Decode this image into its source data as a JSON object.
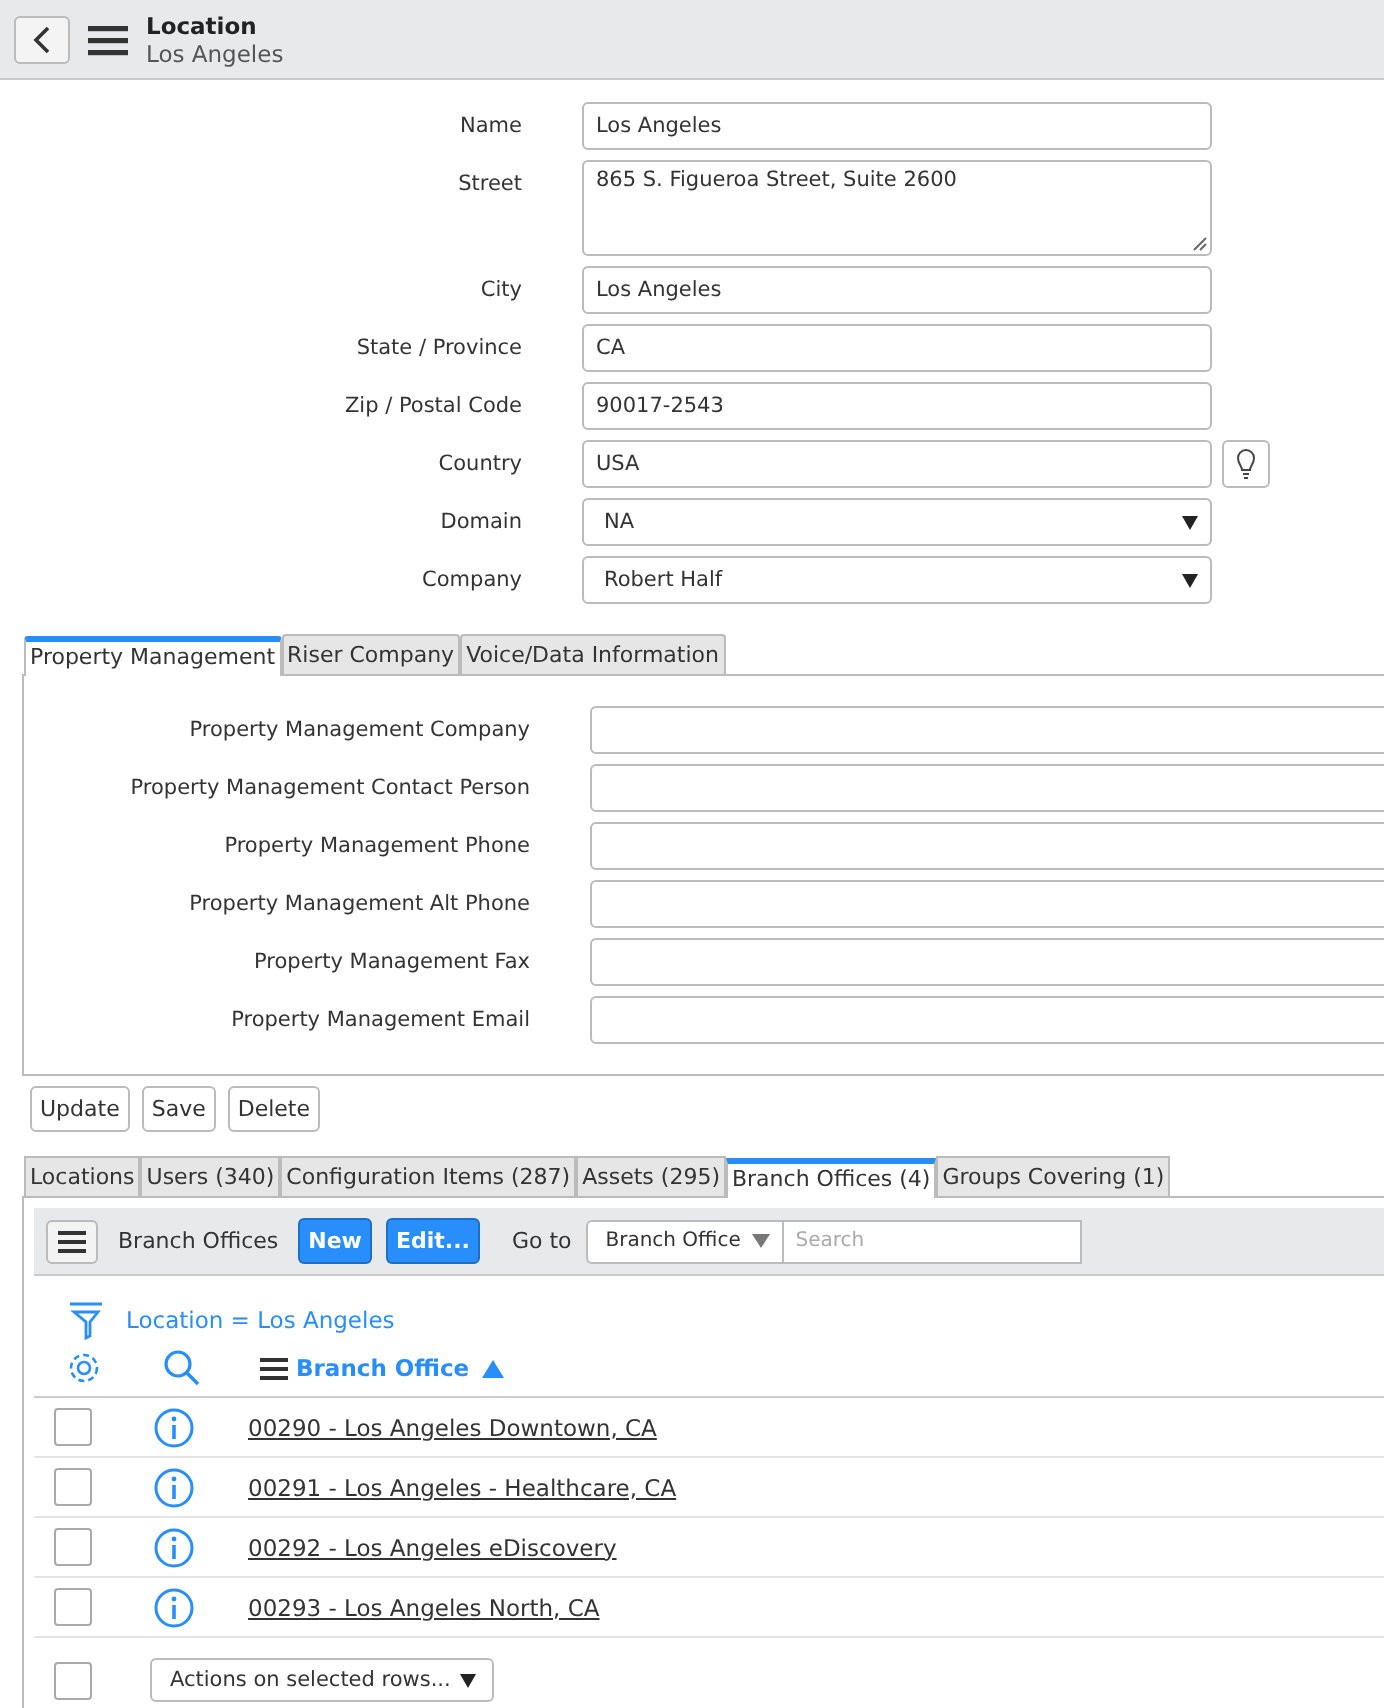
{
  "header": {
    "title": "Location",
    "subtitle": "Los Angeles"
  },
  "fields": [
    {
      "label": "Name",
      "value": "Los Angeles",
      "kind": "text"
    },
    {
      "label": "Street",
      "value": "865 S. Figueroa Street, Suite 2600",
      "kind": "textarea"
    },
    {
      "label": "City",
      "value": "Los Angeles",
      "kind": "text"
    },
    {
      "label": "State / Province",
      "value": "CA",
      "kind": "text"
    },
    {
      "label": "Zip / Postal Code",
      "value": "90017-2543",
      "kind": "text"
    },
    {
      "label": "Country",
      "value": "USA",
      "kind": "lookup"
    },
    {
      "label": "Domain",
      "value": "NA",
      "kind": "select"
    },
    {
      "label": "Company",
      "value": "Robert Half",
      "kind": "select"
    }
  ],
  "section_tabs": [
    {
      "label": "Property Management",
      "selected": true
    },
    {
      "label": "Riser Company",
      "selected": false
    },
    {
      "label": "Voice/Data Information",
      "selected": false
    }
  ],
  "section_fields": [
    {
      "label": "Property Management Company"
    },
    {
      "label": "Property Management Contact Person"
    },
    {
      "label": "Property Management Phone"
    },
    {
      "label": "Property Management Alt Phone"
    },
    {
      "label": "Property Management Fax"
    },
    {
      "label": "Property Management Email"
    }
  ],
  "buttons": [
    "Update",
    "Save",
    "Delete"
  ],
  "related_tabs": [
    {
      "label": "Locations",
      "selected": false
    },
    {
      "label": "Users (340)",
      "selected": false
    },
    {
      "label": "Configuration Items (287)",
      "selected": false
    },
    {
      "label": "Assets (295)",
      "selected": false
    },
    {
      "label": "Branch Offices (4)",
      "selected": true
    },
    {
      "label": "Groups Covering (1)",
      "selected": false
    }
  ],
  "list": {
    "title": "Branch Offices",
    "new_button": "New",
    "edit_button": "Edit...",
    "goto_label": "Go to",
    "goto_select": "Branch Office",
    "search_placeholder": "Search",
    "filter": "Location = Los Angeles",
    "column": "Branch Office",
    "rows": [
      {
        "text": "00290 - Los Angeles Downtown, CA",
        "checked": false
      },
      {
        "text": "00291 - Los Angeles - Healthcare, CA",
        "checked": false
      },
      {
        "text": "00292 - Los Angeles eDiscovery",
        "checked": false
      },
      {
        "text": "00293 - Los Angeles North, CA",
        "checked": false
      }
    ],
    "select_all_checked": false,
    "actions_select": "Actions on selected rows..."
  }
}
